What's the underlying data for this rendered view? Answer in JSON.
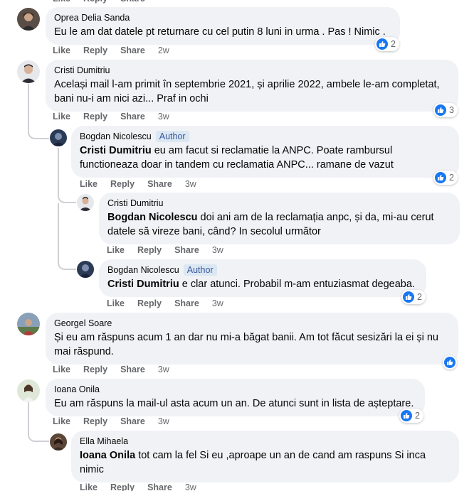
{
  "actions": {
    "like": "Like",
    "reply": "Reply",
    "share": "Share"
  },
  "colors": {
    "bubble": "#f0f2f5",
    "like_blue": "#1877f2",
    "meta_gray": "#65676b",
    "author_badge_bg": "#dbe7f2",
    "author_badge_text": "#385898"
  },
  "comments": [
    {
      "author": "Oprea Delia Sanda",
      "badge": "",
      "mention": "",
      "text": "Eu le am dat datele pt returnare cu cel putin 8 luni in urma . Pas ! Nimic .",
      "time": "2w",
      "reactions": "2",
      "reaction_icon": "like-icon"
    },
    {
      "author": "Cristi Dumitriu",
      "badge": "",
      "mention": "",
      "text": "Același mail l-am primit în septembrie 2021, și aprilie 2022, ambele le-am completat, bani nu-i am nici azi... Praf in ochi",
      "time": "3w",
      "reactions": "3",
      "reaction_icon": "like-icon"
    },
    {
      "author": "Bogdan Nicolescu",
      "badge": "Author",
      "mention": "Cristi Dumitriu",
      "text": " eu am facut si reclamatie la ANPC. Poate rambursul functioneaza doar in tandem cu reclamatia ANPC... ramane de vazut",
      "time": "3w",
      "reactions": "2",
      "reaction_icon": "like-icon"
    },
    {
      "author": "Cristi Dumitriu",
      "badge": "",
      "mention": "Bogdan Nicolescu",
      "text": " doi ani am de la reclamația anpc, și da, mi-au cerut datele să vireze bani, când? In secolul următor",
      "time": "3w",
      "reactions": "",
      "reaction_icon": ""
    },
    {
      "author": "Bogdan Nicolescu",
      "badge": "Author",
      "mention": "Cristi Dumitriu",
      "text": " e clar atunci. Probabil m-am entuziasmat degeaba.",
      "time": "3w",
      "reactions": "2",
      "reaction_icon": "like-icon"
    },
    {
      "author": "Georgel Soare",
      "badge": "",
      "mention": "",
      "text": "Și eu am răspuns acum 1 an dar nu mi-a băgat banii. Am tot făcut sesizări la ei și nu mai răspund.",
      "time": "3w",
      "reactions": "",
      "reaction_icon": "like-icon"
    },
    {
      "author": "Ioana Onila",
      "badge": "",
      "mention": "",
      "text": "Eu am răspuns la mail-ul asta acum un an. De atunci sunt in lista de așteptare.",
      "time": "3w",
      "reactions": "2",
      "reaction_icon": "like-icon"
    },
    {
      "author": "Ella Mihaela",
      "badge": "",
      "mention": "Ioana Onila",
      "text": " tot cam la fel Si eu ,aproape un an de cand am raspuns Si inca nimic",
      "time": "3w",
      "reactions": "",
      "reaction_icon": ""
    }
  ]
}
